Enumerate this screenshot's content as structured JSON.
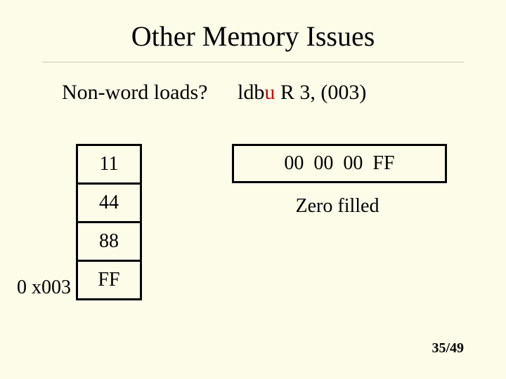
{
  "title": "Other Memory Issues",
  "question": "Non-word loads?",
  "instr": {
    "op_prefix": "ldb",
    "op_suffix": "u",
    "args": "  R 3, (003)"
  },
  "mem": {
    "cells": [
      "11",
      "44",
      "88",
      "FF"
    ],
    "addr_label": "0 x003"
  },
  "register": "00  00  00  FF",
  "caption": "Zero filled",
  "pagenum": "35/49"
}
